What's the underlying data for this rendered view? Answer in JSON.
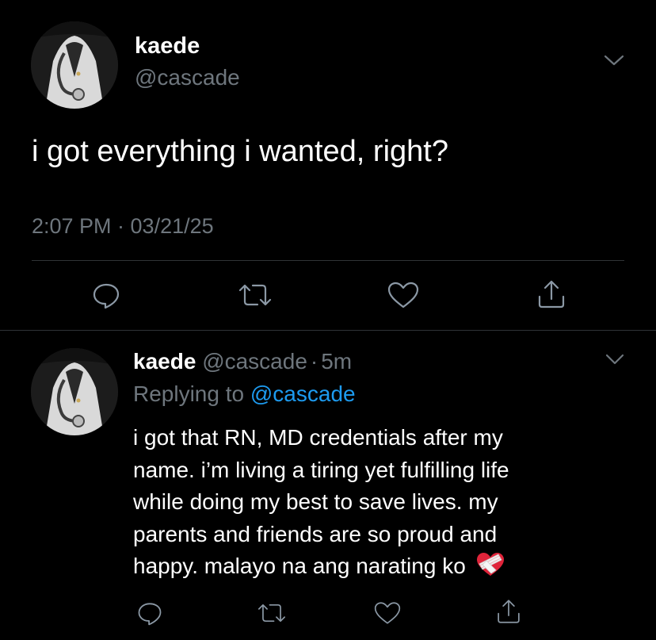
{
  "main_tweet": {
    "display_name": "kaede",
    "handle": "@cascade",
    "text": "i got everything i wanted, right?",
    "timestamp": "2:07 PM · 03/21/25",
    "icons": {
      "menu": "chevron-down-icon",
      "reply": "reply-icon",
      "retweet": "retweet-icon",
      "like": "heart-icon",
      "share": "share-icon"
    }
  },
  "reply_tweet": {
    "display_name": "kaede",
    "handle": "@cascade",
    "separator": "·",
    "age": "5m",
    "replying_to_label": "Replying to",
    "replying_to_handle": "@cascade",
    "lines": [
      "i got that RN, MD credentials after my",
      "name. i’m living a tiring yet fulfilling life",
      "while doing my best to save lives. my",
      "parents and friends are so proud and",
      "happy. malayo na ang narating ko"
    ],
    "emoji": "heart-with-bandage-icon"
  },
  "colors": {
    "background": "#000000",
    "text": "#ffffff",
    "muted": "#6e767d",
    "link": "#1d9bf0",
    "divider": "#2f3336",
    "icon": "#8b98a5"
  }
}
